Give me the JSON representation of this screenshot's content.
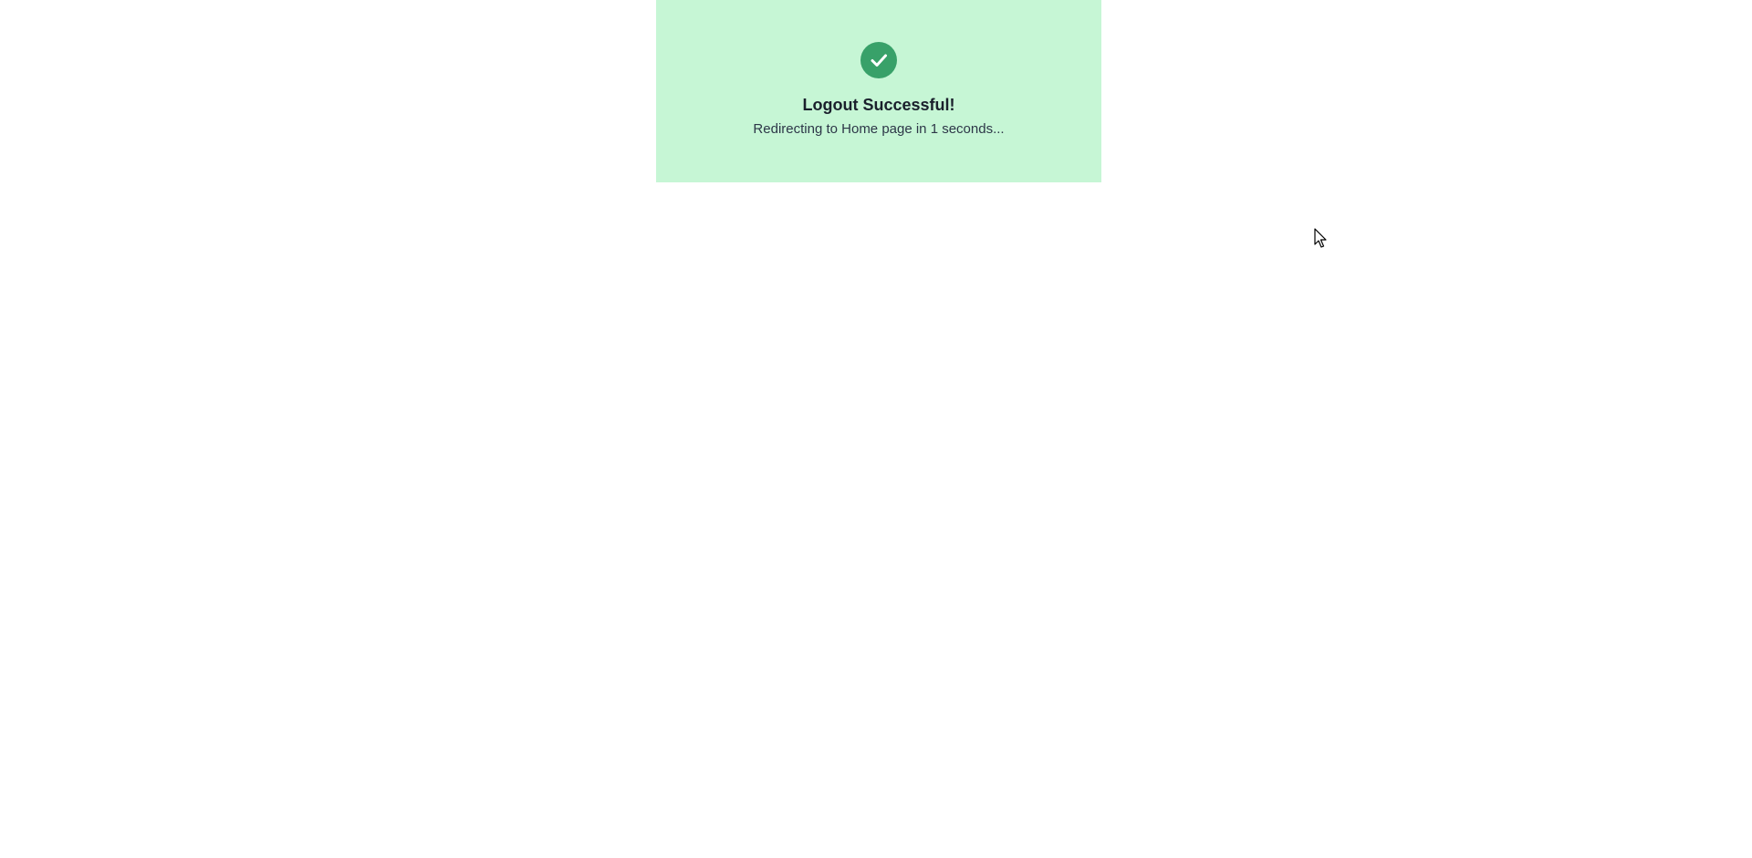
{
  "toast": {
    "status": "success",
    "icon": "check-circle-icon",
    "title": "Logout Successful!",
    "message": "Redirecting to Home page in 1 seconds...",
    "colors": {
      "background": "#c6f6d5",
      "icon": "#38a169",
      "title": "#1a202c",
      "message": "#2d3748"
    }
  },
  "cursor": {
    "icon": "mouse-pointer-icon"
  }
}
